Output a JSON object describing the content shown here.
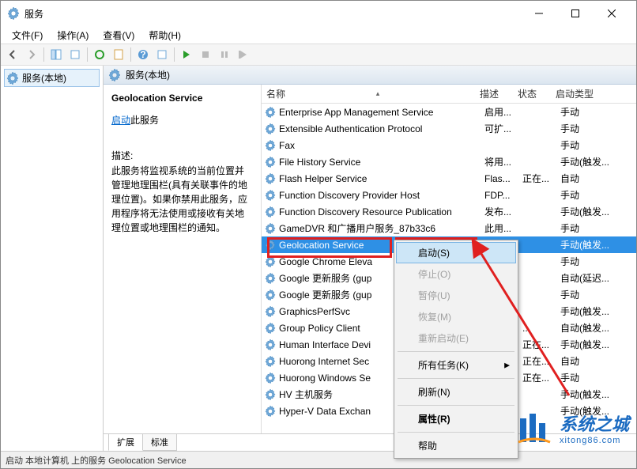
{
  "window": {
    "title": "服务"
  },
  "menus": {
    "file": "文件(F)",
    "action": "操作(A)",
    "view": "查看(V)",
    "help": "帮助(H)"
  },
  "nav": {
    "services_local": "服务(本地)"
  },
  "main_header": "服务(本地)",
  "detail": {
    "name": "Geolocation Service",
    "start": "启动",
    "start_suffix": "此服务",
    "desc_label": "描述:",
    "desc": "此服务将监视系统的当前位置并管理地理围栏(具有关联事件的地理位置)。如果你禁用此服务，应用程序将无法使用或接收有关地理位置或地理围栏的通知。"
  },
  "columns": {
    "name": "名称",
    "desc": "描述",
    "status": "状态",
    "startup": "启动类型"
  },
  "services": [
    {
      "name": "Enterprise App Management Service",
      "desc": "启用...",
      "status": "",
      "startup": "手动"
    },
    {
      "name": "Extensible Authentication Protocol",
      "desc": "可扩...",
      "status": "",
      "startup": "手动"
    },
    {
      "name": "Fax",
      "desc": "",
      "status": "",
      "startup": "手动"
    },
    {
      "name": "File History Service",
      "desc": "将用...",
      "status": "",
      "startup": "手动(触发..."
    },
    {
      "name": "Flash Helper Service",
      "desc": "Flas...",
      "status": "正在...",
      "startup": "自动"
    },
    {
      "name": "Function Discovery Provider Host",
      "desc": "FDP...",
      "status": "",
      "startup": "手动"
    },
    {
      "name": "Function Discovery Resource Publication",
      "desc": "发布...",
      "status": "",
      "startup": "手动(触发..."
    },
    {
      "name": "GameDVR 和广播用户服务_87b33c6",
      "desc": "此用...",
      "status": "",
      "startup": "手动"
    },
    {
      "name": "Geolocation Service",
      "desc": "",
      "status": "",
      "startup": "手动(触发...",
      "selected": true
    },
    {
      "name": "Google Chrome Eleva",
      "desc": "",
      "status": "",
      "startup": "手动"
    },
    {
      "name": "Google 更新服务 (gup",
      "desc": "",
      "status": "",
      "startup": "自动(延迟..."
    },
    {
      "name": "Google 更新服务 (gup",
      "desc": "",
      "status": "",
      "startup": "手动"
    },
    {
      "name": "GraphicsPerfSvc",
      "desc": "",
      "status": "",
      "startup": "手动(触发..."
    },
    {
      "name": "Group Policy Client",
      "desc": "",
      "status": "...",
      "startup": "自动(触发..."
    },
    {
      "name": "Human Interface Devi",
      "desc": "",
      "status": "正在...",
      "startup": "手动(触发..."
    },
    {
      "name": "Huorong Internet Sec",
      "desc": "",
      "status": "正在...",
      "startup": "自动"
    },
    {
      "name": "Huorong Windows Se",
      "desc": "",
      "status": "正在...",
      "startup": "手动"
    },
    {
      "name": "HV 主机服务",
      "desc": "",
      "status": "",
      "startup": "手动(触发..."
    },
    {
      "name": "Hyper-V Data Exchan",
      "desc": "",
      "status": "",
      "startup": "手动(触发..."
    }
  ],
  "context_menu": {
    "start": "启动(S)",
    "stop": "停止(O)",
    "pause": "暂停(U)",
    "resume": "恢复(M)",
    "restart": "重新启动(E)",
    "all_tasks": "所有任务(K)",
    "refresh": "刷新(N)",
    "properties": "属性(R)",
    "help": "帮助"
  },
  "tabs": {
    "extended": "扩展",
    "standard": "标准"
  },
  "statusbar": "启动 本地计算机 上的服务 Geolocation Service",
  "watermark": {
    "main": "系统之城",
    "sub": "xitong86.com"
  }
}
